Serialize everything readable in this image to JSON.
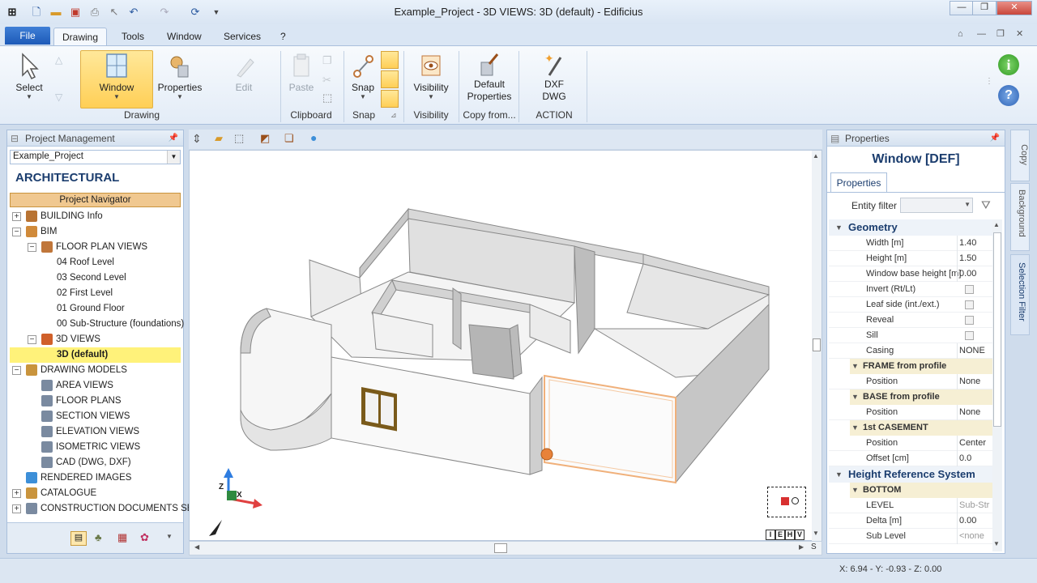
{
  "window": {
    "title": "Example_Project - 3D VIEWS: 3D (default) - Edificius",
    "minimize": "—",
    "restore": "❐",
    "close": "✕"
  },
  "menu": {
    "file": "File",
    "items": [
      "Drawing",
      "Tools",
      "Window",
      "Services",
      "?"
    ]
  },
  "ribbon": {
    "select": "Select",
    "window": "Window",
    "properties": "Properties",
    "edit": "Edit",
    "group_drawing": "Drawing",
    "paste": "Paste",
    "group_clipboard": "Clipboard",
    "snap": "Snap",
    "group_snap": "Snap",
    "visibility": "Visibility",
    "group_visibility": "Visibility",
    "default_properties": "Default Properties",
    "group_copy_from": "Copy from...",
    "dxf_dwg": "DXF DWG",
    "group_action": "ACTION"
  },
  "project_panel": {
    "title": "Project Management",
    "project": "Example_Project",
    "section": "ARCHITECTURAL",
    "navigator": "Project Navigator",
    "tree": [
      {
        "label": "BUILDING Info",
        "level": 0,
        "exp": "+",
        "icon": "#b87333"
      },
      {
        "label": "BIM",
        "level": 0,
        "exp": "−",
        "icon": "#d08a3a"
      },
      {
        "label": "FLOOR PLAN VIEWS",
        "level": 1,
        "exp": "−",
        "icon": "#c0763a"
      },
      {
        "label": "04 Roof Level",
        "level": 2,
        "exp": "",
        "icon": ""
      },
      {
        "label": "03 Second Level",
        "level": 2,
        "exp": "",
        "icon": ""
      },
      {
        "label": "02 First Level",
        "level": 2,
        "exp": "",
        "icon": ""
      },
      {
        "label": "01 Ground Floor",
        "level": 2,
        "exp": "",
        "icon": ""
      },
      {
        "label": "00 Sub-Structure (foundations)",
        "level": 2,
        "exp": "",
        "icon": ""
      },
      {
        "label": "3D VIEWS",
        "level": 1,
        "exp": "−",
        "icon": "#d0602a"
      },
      {
        "label": "3D (default)",
        "level": 2,
        "exp": "",
        "icon": "",
        "selected": true
      },
      {
        "label": "DRAWING MODELS",
        "level": 0,
        "exp": "−",
        "icon": "#c9943d"
      },
      {
        "label": "AREA VIEWS",
        "level": 1,
        "exp": "",
        "icon": "#7a8aa0"
      },
      {
        "label": "FLOOR PLANS",
        "level": 1,
        "exp": "",
        "icon": "#7a8aa0"
      },
      {
        "label": "SECTION VIEWS",
        "level": 1,
        "exp": "",
        "icon": "#7a8aa0"
      },
      {
        "label": "ELEVATION VIEWS",
        "level": 1,
        "exp": "",
        "icon": "#7a8aa0"
      },
      {
        "label": "ISOMETRIC VIEWS",
        "level": 1,
        "exp": "",
        "icon": "#7a8aa0"
      },
      {
        "label": "CAD (DWG, DXF)",
        "level": 1,
        "exp": "",
        "icon": "#7a8aa0"
      },
      {
        "label": "RENDERED IMAGES",
        "level": 0,
        "exp": "",
        "icon": "#3d8fd8"
      },
      {
        "label": "CATALOGUE",
        "level": 0,
        "exp": "+",
        "icon": "#c9943d"
      },
      {
        "label": "CONSTRUCTION DOCUMENTS SET",
        "level": 0,
        "exp": "+",
        "icon": "#7a8aa0"
      }
    ]
  },
  "properties_panel": {
    "title": "Properties",
    "heading": "Window [DEF]",
    "tab": "Properties",
    "entity_filter": "Entity filter",
    "rows": [
      {
        "kind": "section",
        "label": "Geometry"
      },
      {
        "kind": "row",
        "name": "Width  [m]",
        "value": "1.40"
      },
      {
        "kind": "row",
        "name": "Height  [m]",
        "value": "1.50"
      },
      {
        "kind": "row",
        "name": "Window base height  [m]",
        "value": "0.00"
      },
      {
        "kind": "check",
        "name": "Invert (Rt/Lt)"
      },
      {
        "kind": "check",
        "name": "Leaf side (int./ext.)"
      },
      {
        "kind": "check",
        "name": "Reveal"
      },
      {
        "kind": "check",
        "name": "Sill"
      },
      {
        "kind": "row",
        "name": "Casing",
        "value": "NONE"
      },
      {
        "kind": "sub",
        "label": "FRAME from profile"
      },
      {
        "kind": "row",
        "name": "Position",
        "value": "None"
      },
      {
        "kind": "sub",
        "label": "BASE from profile"
      },
      {
        "kind": "row",
        "name": "Position",
        "value": "None"
      },
      {
        "kind": "sub",
        "label": "1st CASEMENT"
      },
      {
        "kind": "row",
        "name": "Position",
        "value": "Center"
      },
      {
        "kind": "row",
        "name": "Offset  [cm]",
        "value": "0.0"
      },
      {
        "kind": "section",
        "label": "Height Reference System"
      },
      {
        "kind": "sub",
        "label": "BOTTOM"
      },
      {
        "kind": "row",
        "name": "LEVEL",
        "value": "Sub-Str",
        "grey": true
      },
      {
        "kind": "row",
        "name": "Delta  [m]",
        "value": "0.00"
      },
      {
        "kind": "row",
        "name": "Sub Level",
        "value": "<none",
        "grey": true
      }
    ]
  },
  "side_tabs": [
    "Copy",
    "Background",
    "Selection Filter"
  ],
  "view_cube": {
    "labels": [
      "I",
      "E",
      "H",
      "V"
    ]
  },
  "axis": {
    "z": "Z",
    "x": "X"
  },
  "status": {
    "coords": "X: 6.94 - Y: -0.93 - Z: 0.00",
    "scroll_s": "S"
  }
}
